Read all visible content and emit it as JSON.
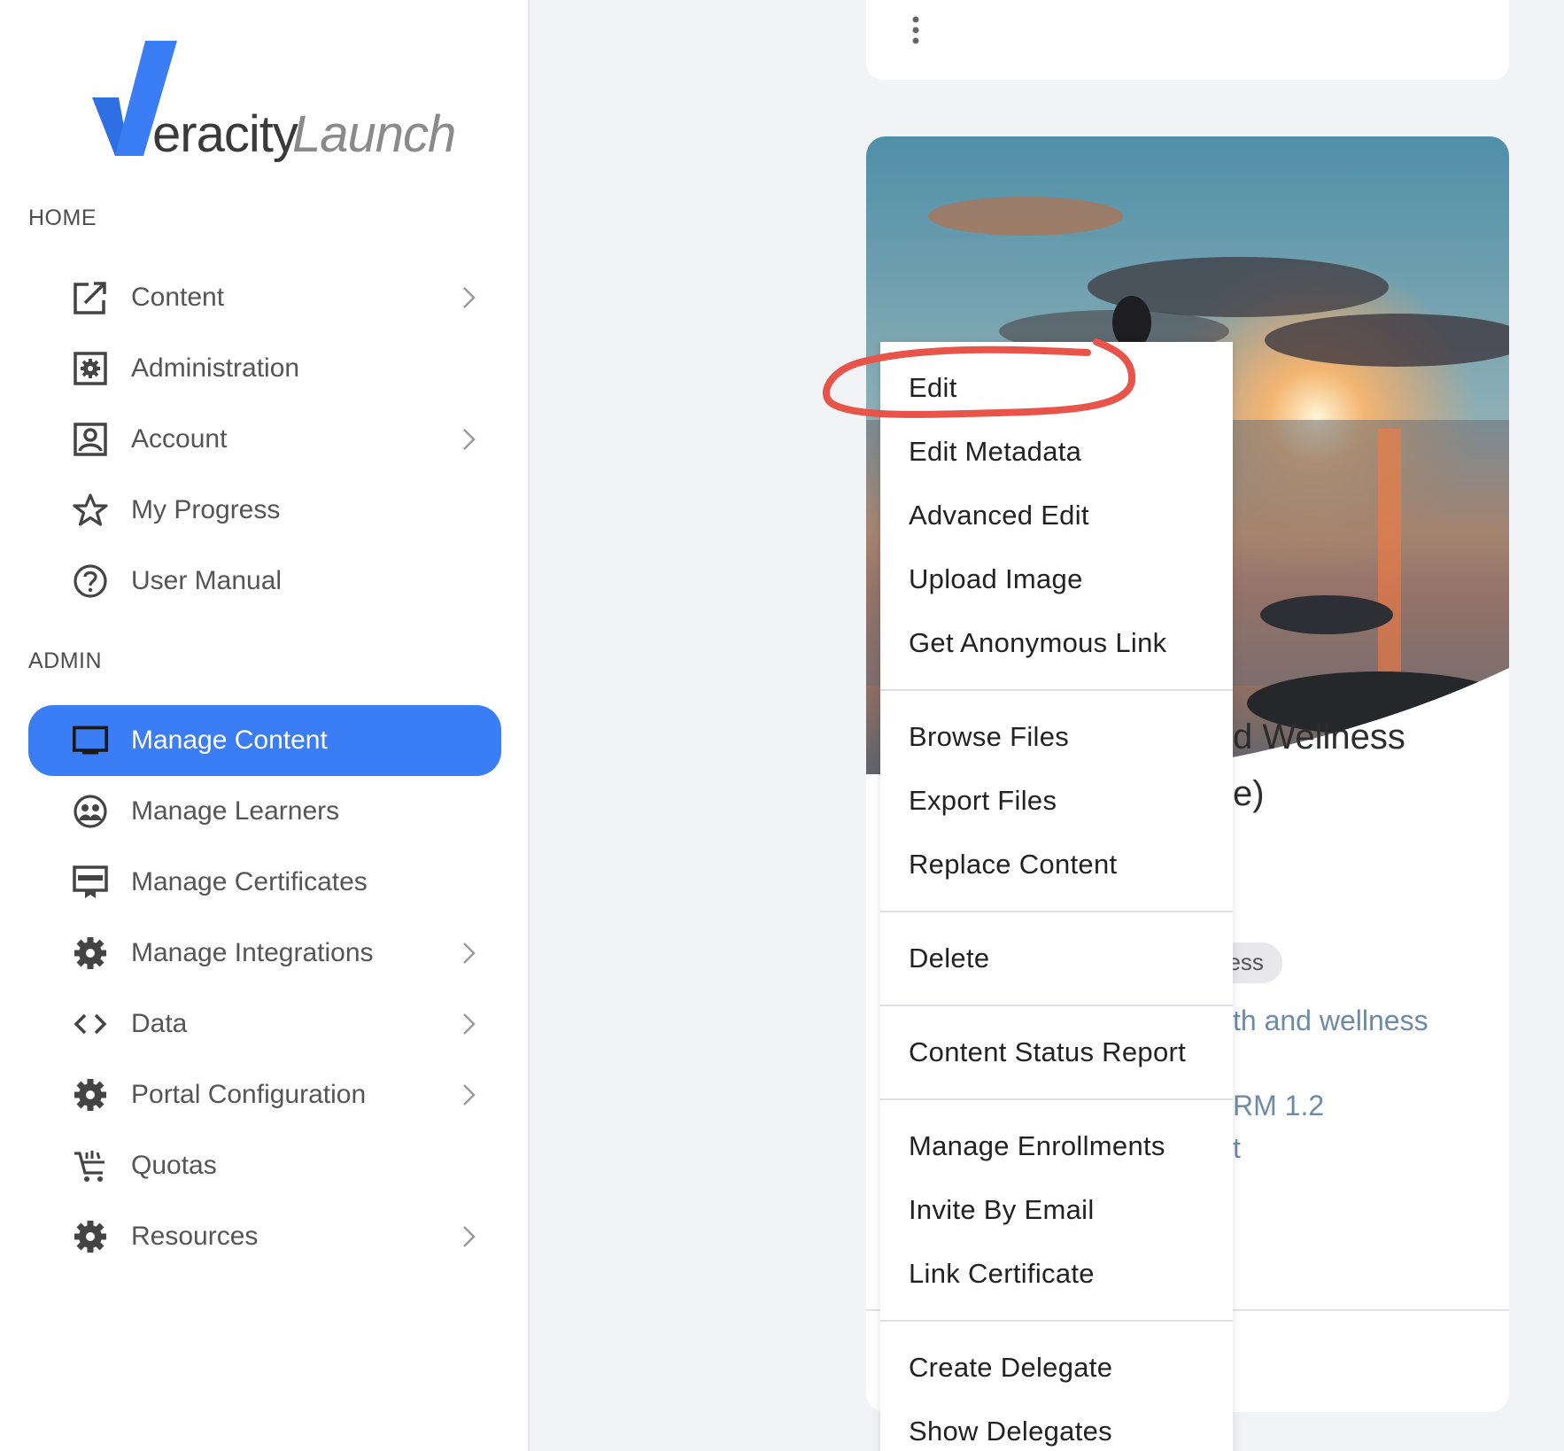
{
  "brand": {
    "mark": "V",
    "word1": "eracity",
    "word2": "Launch"
  },
  "sections": {
    "home": "HOME",
    "admin": "ADMIN"
  },
  "home_items": [
    {
      "label": "Content",
      "icon": "external-link-icon"
    },
    {
      "label": "Administration",
      "icon": "gear-box-icon"
    },
    {
      "label": "Account",
      "icon": "account-box-icon"
    },
    {
      "label": "My Progress",
      "icon": "star-icon"
    },
    {
      "label": "User Manual",
      "icon": "question-circle-icon"
    }
  ],
  "admin_items": [
    {
      "label": "Manage Content",
      "icon": "monitor-icon",
      "active": true
    },
    {
      "label": "Manage Learners",
      "icon": "learners-icon"
    },
    {
      "label": "Manage Certificates",
      "icon": "certificate-icon"
    },
    {
      "label": "Manage Integrations",
      "icon": "gear-icon"
    },
    {
      "label": "Data",
      "icon": "code-icon"
    },
    {
      "label": "Portal Configuration",
      "icon": "gear-icon"
    },
    {
      "label": "Quotas",
      "icon": "cart-icon"
    },
    {
      "label": "Resources",
      "icon": "gear-icon"
    }
  ],
  "card": {
    "title_line1": "d Wellness",
    "title_line2": "e)",
    "tag": "ness",
    "subtitle": "th and wellness",
    "meta1": "RM 1.2",
    "meta2": "t"
  },
  "menu": {
    "items": [
      "Edit",
      "Edit Metadata",
      "Advanced Edit",
      "Upload Image",
      "Get Anonymous Link",
      "Browse Files",
      "Export Files",
      "Replace Content",
      "Delete",
      "Content Status Report",
      "Manage Enrollments",
      "Invite By Email",
      "Link Certificate",
      "Create Delegate",
      "Show Delegates"
    ]
  },
  "colors": {
    "accent": "#3a7df5",
    "annotation": "#e8544a"
  }
}
